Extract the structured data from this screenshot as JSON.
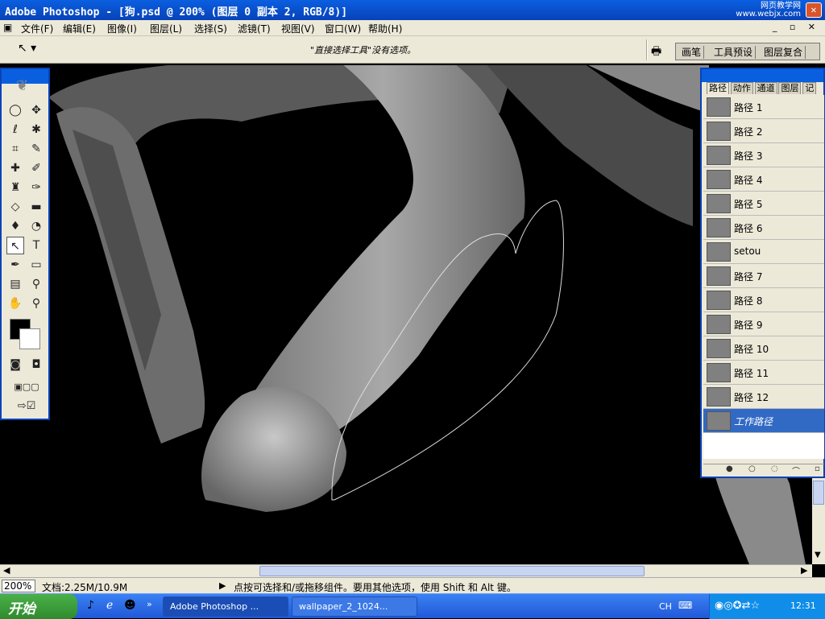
{
  "window": {
    "title": "Adobe Photoshop - [狗.psd @ 200% (图层 0 副本 2, RGB/8)]",
    "watermark_line1": "网页教学网",
    "watermark_line2": "www.webjx.com"
  },
  "menu": [
    "文件(F)",
    "编辑(E)",
    "图像(I)",
    "图层(L)",
    "选择(S)",
    "滤镜(T)",
    "视图(V)",
    "窗口(W)",
    "帮助(H)"
  ],
  "options": {
    "message": "\"直接选择工具\"没有选项。"
  },
  "palette_well": [
    "画笔",
    "工具预设",
    "图层复合"
  ],
  "panel": {
    "tabs": [
      "路径",
      "动作",
      "通道",
      "图层",
      "记"
    ],
    "paths": [
      "路径 1",
      "路径 2",
      "路径 3",
      "路径 4",
      "路径 5",
      "路径 6",
      "setou",
      "路径 7",
      "路径 8",
      "路径 9",
      "路径 10",
      "路径 11",
      "路径 12",
      "工作路径"
    ],
    "active_path": "工作路径"
  },
  "status": {
    "zoom": "200%",
    "doc_size": "文档:2.25M/10.9M",
    "message": "点按可选择和/或拖移组件。要用其他选项，使用 Shift 和 Alt 键。"
  },
  "taskbar": {
    "start": "开始",
    "tasks": [
      "Adobe Photoshop ...",
      "wallpaper_2_1024..."
    ],
    "lang": "CH",
    "clock": "12:31"
  }
}
